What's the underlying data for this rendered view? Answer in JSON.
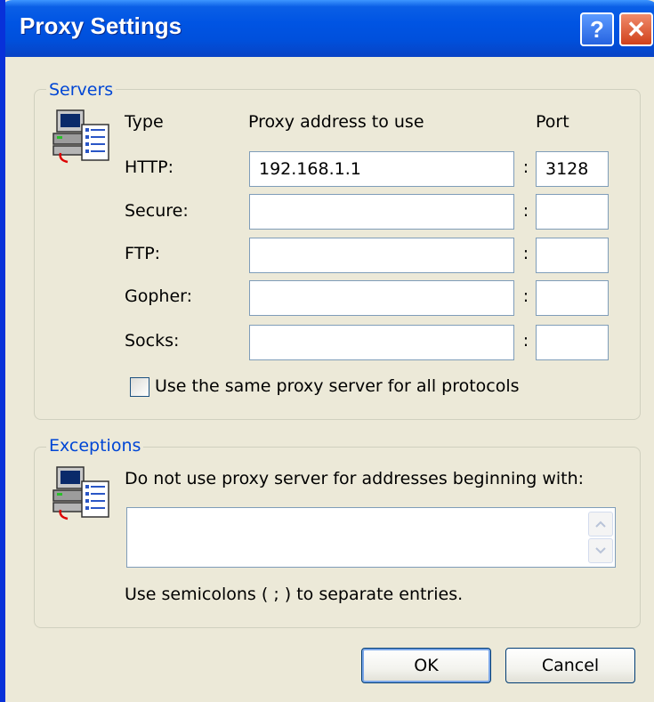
{
  "window": {
    "title": "Proxy Settings"
  },
  "titlebar_buttons": {
    "help": "?",
    "close": "✕"
  },
  "servers": {
    "group_label": "Servers",
    "icon": "network-computer-icon",
    "headers": {
      "type": "Type",
      "address": "Proxy address to use",
      "port": "Port"
    },
    "rows": [
      {
        "type": "HTTP:",
        "address": "192.168.1.1",
        "port": "3128"
      },
      {
        "type": "Secure:",
        "address": "",
        "port": ""
      },
      {
        "type": "FTP:",
        "address": "",
        "port": ""
      },
      {
        "type": "Gopher:",
        "address": "",
        "port": ""
      },
      {
        "type": "Socks:",
        "address": "",
        "port": ""
      }
    ],
    "colon": ":",
    "same_proxy_label": "Use the same proxy server for all protocols",
    "same_proxy_checked": false
  },
  "exceptions": {
    "group_label": "Exceptions",
    "icon": "network-computer-icon",
    "instruction": "Do not use proxy server for addresses beginning with:",
    "value": "",
    "hint": "Use semicolons ( ; ) to separate entries."
  },
  "buttons": {
    "ok": "OK",
    "cancel": "Cancel"
  },
  "colors": {
    "title_bar": "#0054E3",
    "group_label": "#0046D5",
    "dialog_bg": "#ECE9D8"
  }
}
